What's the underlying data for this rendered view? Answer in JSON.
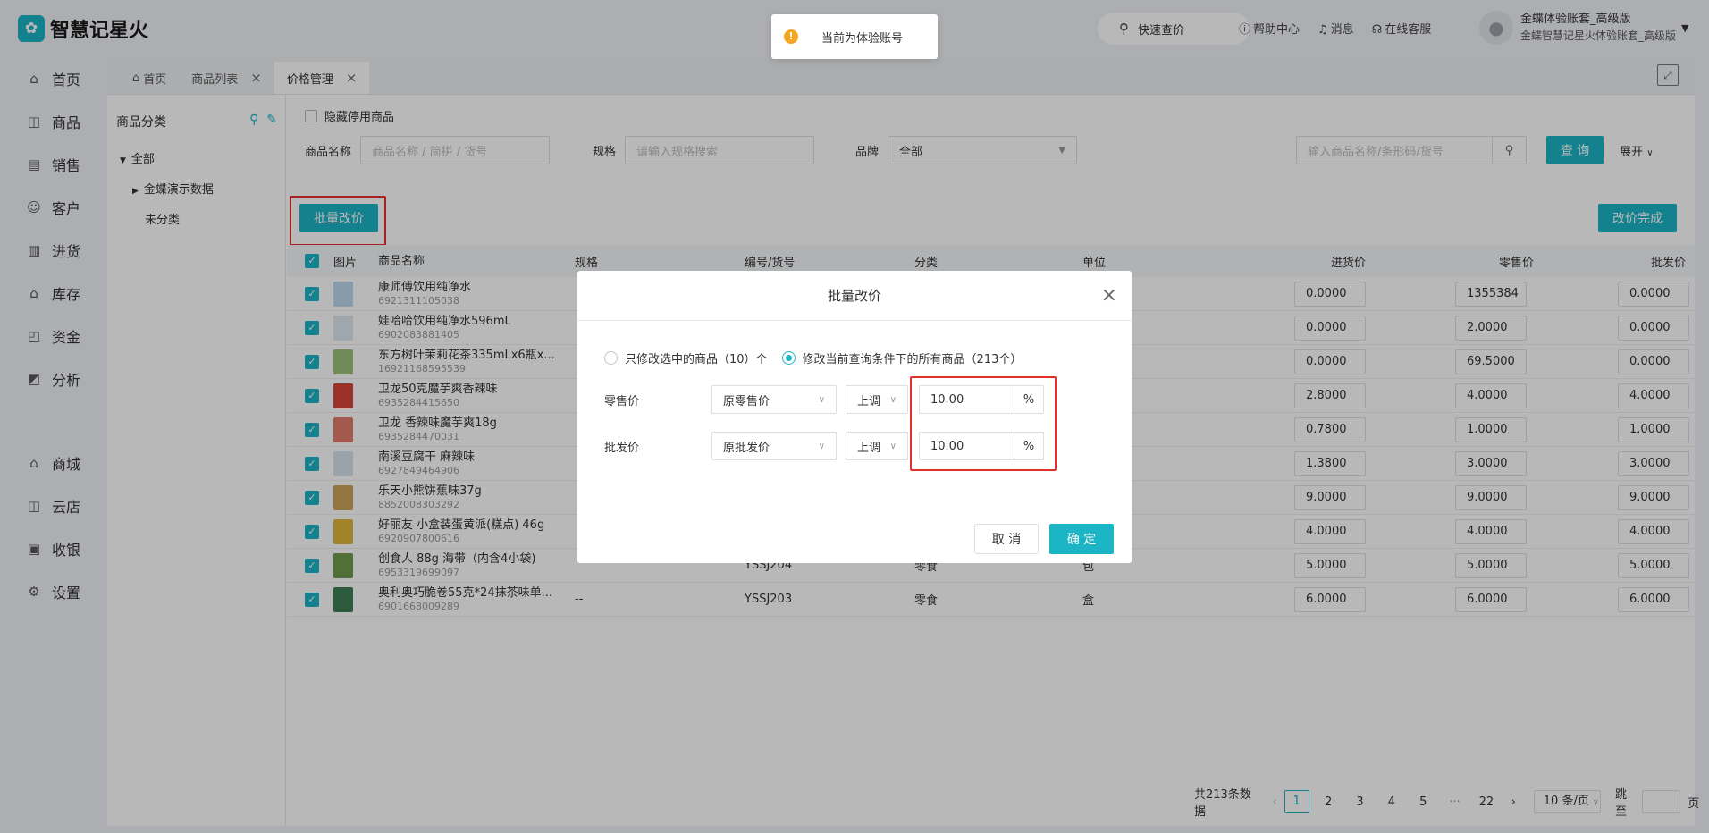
{
  "app": {
    "logo_mark": "✿",
    "name": "智慧记星火"
  },
  "topbar": {
    "quick_search": "快速查价",
    "help": "帮助中心",
    "messages": "消息",
    "service": "在线客服",
    "user_name": "金蝶体验账套_高级版",
    "user_sub": "金蝶智慧记星火体验账套_高级版"
  },
  "toast": {
    "text": "当前为体验账号"
  },
  "sidebar": {
    "items": [
      {
        "icon": "⌂",
        "label": "首页"
      },
      {
        "icon": "◫",
        "label": "商品"
      },
      {
        "icon": "▤",
        "label": "销售"
      },
      {
        "icon": "☺",
        "label": "客户"
      },
      {
        "icon": "▥",
        "label": "进货"
      },
      {
        "icon": "⌂",
        "label": "库存"
      },
      {
        "icon": "◰",
        "label": "资金"
      },
      {
        "icon": "◩",
        "label": "分析"
      }
    ],
    "items2": [
      {
        "icon": "⌂",
        "label": "商城"
      },
      {
        "icon": "◫",
        "label": "云店"
      },
      {
        "icon": "▣",
        "label": "收银"
      },
      {
        "icon": "⚙",
        "label": "设置"
      }
    ]
  },
  "tabs": [
    {
      "label": "首页"
    },
    {
      "label": "商品列表"
    },
    {
      "label": "价格管理"
    }
  ],
  "category": {
    "title": "商品分类",
    "all": "全部",
    "demo": "金蝶演示数据",
    "none": "未分类"
  },
  "filters": {
    "hide_disabled": "隐藏停用商品",
    "name_label": "商品名称",
    "name_placeholder": "商品名称 / 简拼 / 货号",
    "spec_label": "规格",
    "spec_placeholder": "请输入规格搜索",
    "brand_label": "品牌",
    "brand_value": "全部",
    "search_placeholder": "输入商品名称/条形码/货号",
    "query": "查 询",
    "expand": "展开"
  },
  "actions": {
    "batch": "批量改价",
    "done": "改价完成"
  },
  "table": {
    "headers": {
      "img": "图片",
      "name": "商品名称",
      "spec": "规格",
      "code": "编号/货号",
      "cat": "分类",
      "unit": "单位",
      "buy": "进货价",
      "retail": "零售价",
      "whole": "批发价"
    },
    "rows": [
      {
        "name": "康师傅饮用纯净水",
        "barcode": "6921311105038",
        "spec": "",
        "code": "",
        "cat": "",
        "unit": "",
        "buy": "0.0000",
        "retail": "1355384",
        "whole": "0.0000",
        "color": "#bcd7ee"
      },
      {
        "name": "娃哈哈饮用纯净水596mL",
        "barcode": "6902083881405",
        "spec": "",
        "code": "",
        "cat": "",
        "unit": "",
        "buy": "0.0000",
        "retail": "2.0000",
        "whole": "0.0000",
        "color": "#dde6ef"
      },
      {
        "name": "东方树叶茉莉花茶335mLx6瓶x...",
        "barcode": "16921168595539",
        "spec": "",
        "code": "",
        "cat": "",
        "unit": "",
        "buy": "0.0000",
        "retail": "69.5000",
        "whole": "0.0000",
        "color": "#9bbf7a"
      },
      {
        "name": "卫龙50克魔芋爽香辣味",
        "barcode": "6935284415650",
        "spec": "",
        "code": "",
        "cat": "",
        "unit": "",
        "buy": "2.8000",
        "retail": "4.0000",
        "whole": "4.0000",
        "color": "#d8453a"
      },
      {
        "name": "卫龙 香辣味魔芋爽18g",
        "barcode": "6935284470031",
        "spec": "",
        "code": "",
        "cat": "",
        "unit": "",
        "buy": "0.7800",
        "retail": "1.0000",
        "whole": "1.0000",
        "color": "#e37c6e"
      },
      {
        "name": "南溪豆腐干 麻辣味",
        "barcode": "6927849464906",
        "spec": "",
        "code": "",
        "cat": "",
        "unit": "",
        "buy": "1.3800",
        "retail": "3.0000",
        "whole": "3.0000",
        "color": "#d6e2ea"
      },
      {
        "name": "乐天小熊饼蕉味37g",
        "barcode": "8852008303292",
        "spec": "",
        "code": "",
        "cat": "",
        "unit": "",
        "buy": "9.0000",
        "retail": "9.0000",
        "whole": "9.0000",
        "color": "#c9a45a"
      },
      {
        "name": "好丽友 小盒装蛋黄派(糕点) 46g",
        "barcode": "6920907800616",
        "spec": "",
        "code": "",
        "cat": "",
        "unit": "",
        "buy": "4.0000",
        "retail": "4.0000",
        "whole": "4.0000",
        "color": "#e0b63a"
      },
      {
        "name": "创食人 88g 海带（内含4小袋)",
        "barcode": "6953319699097",
        "spec": "",
        "code": "YSSJ204",
        "cat": "零食",
        "unit": "包",
        "buy": "5.0000",
        "retail": "5.0000",
        "whole": "5.0000",
        "color": "#6f9b4e"
      },
      {
        "name": "奥利奥巧脆卷55克*24抹茶味单...",
        "barcode": "6901668009289",
        "spec": "--",
        "code": "YSSJ203",
        "cat": "零食",
        "unit": "盒",
        "buy": "6.0000",
        "retail": "6.0000",
        "whole": "6.0000",
        "color": "#3f7f57"
      }
    ]
  },
  "pager": {
    "total": "共213条数据",
    "pages": [
      "1",
      "2",
      "3",
      "4",
      "5",
      "···",
      "22"
    ],
    "size": "10 条/页",
    "jump": "跳至",
    "page_unit": "页"
  },
  "modal": {
    "title": "批量改价",
    "opt_selected": "只修改选中的商品（10）个",
    "opt_all": "修改当前查询条件下的所有商品（213个）",
    "retail_label": "零售价",
    "retail_base": "原零售价",
    "retail_dir": "上调",
    "retail_value": "10.00",
    "whole_label": "批发价",
    "whole_base": "原批发价",
    "whole_dir": "上调",
    "whole_value": "10.00",
    "unit": "%",
    "cancel": "取 消",
    "ok": "确 定"
  },
  "colors": {
    "accent": "#1bb5c5",
    "highlight": "#e5302a",
    "warning": "#f5a623"
  }
}
